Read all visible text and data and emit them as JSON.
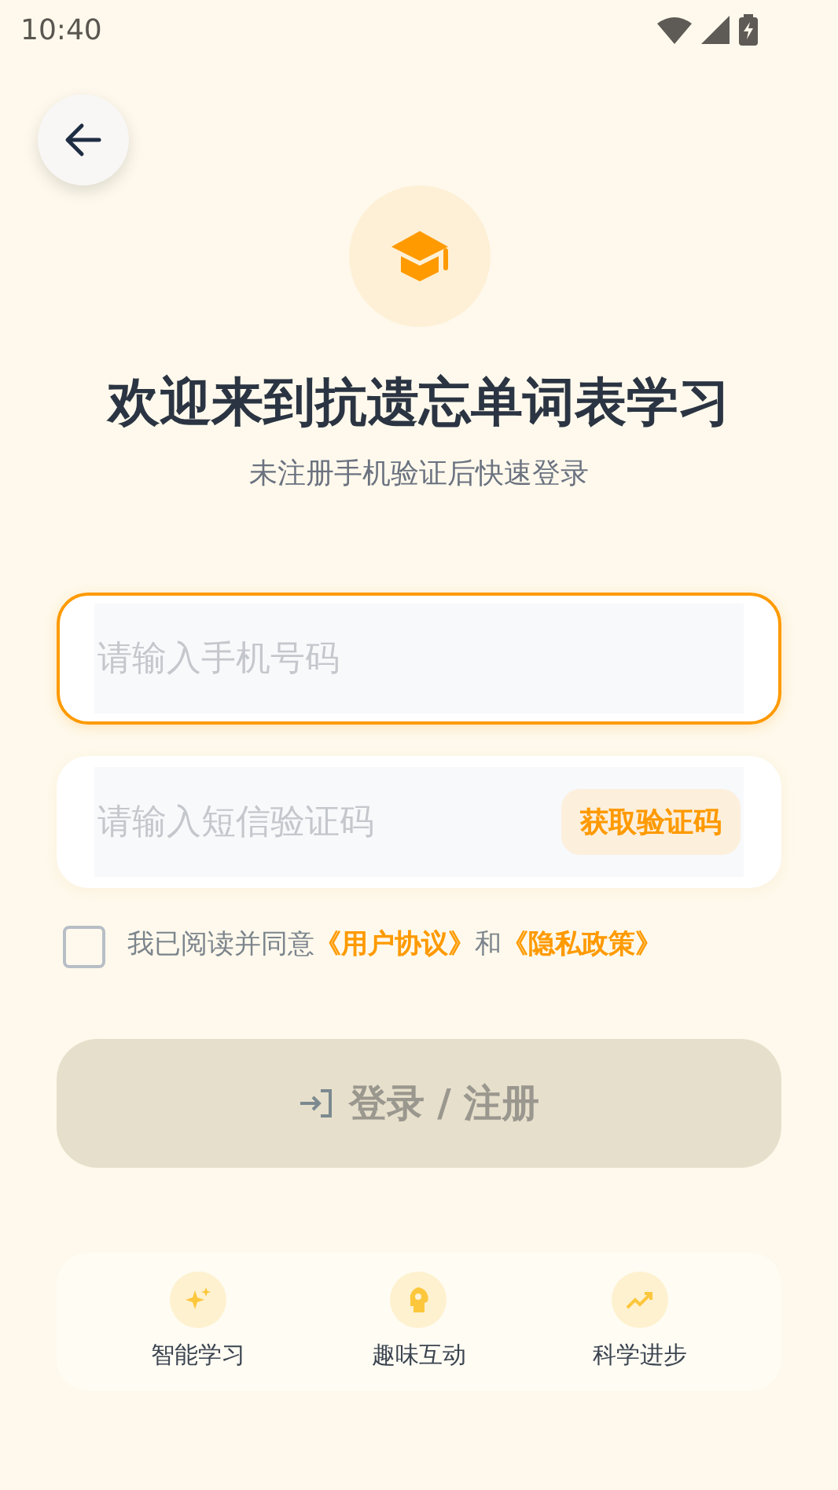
{
  "status_bar": {
    "time": "10:40"
  },
  "header": {
    "title": "欢迎来到抗遗忘单词表学习",
    "subtitle": "未注册手机验证后快速登录"
  },
  "phone_field": {
    "placeholder": "请输入手机号码",
    "focused": true
  },
  "code_field": {
    "placeholder": "请输入短信验证码",
    "focused": false,
    "send_button": "获取验证码"
  },
  "agreement": {
    "checked": false,
    "parts": [
      {
        "kind": "text",
        "text": "我已阅读并同意"
      },
      {
        "kind": "link",
        "text": "《用户协议》"
      },
      {
        "kind": "text",
        "text": "和"
      },
      {
        "kind": "link",
        "text": "《隐私政策》"
      }
    ]
  },
  "login_button": {
    "label": "登录 / 注册",
    "disabled": true
  },
  "features": [
    {
      "kind": "sparkles",
      "label": "智能学习"
    },
    {
      "kind": "bulb",
      "label": "趣味互动"
    },
    {
      "kind": "trend",
      "label": "科学进步"
    }
  ]
}
